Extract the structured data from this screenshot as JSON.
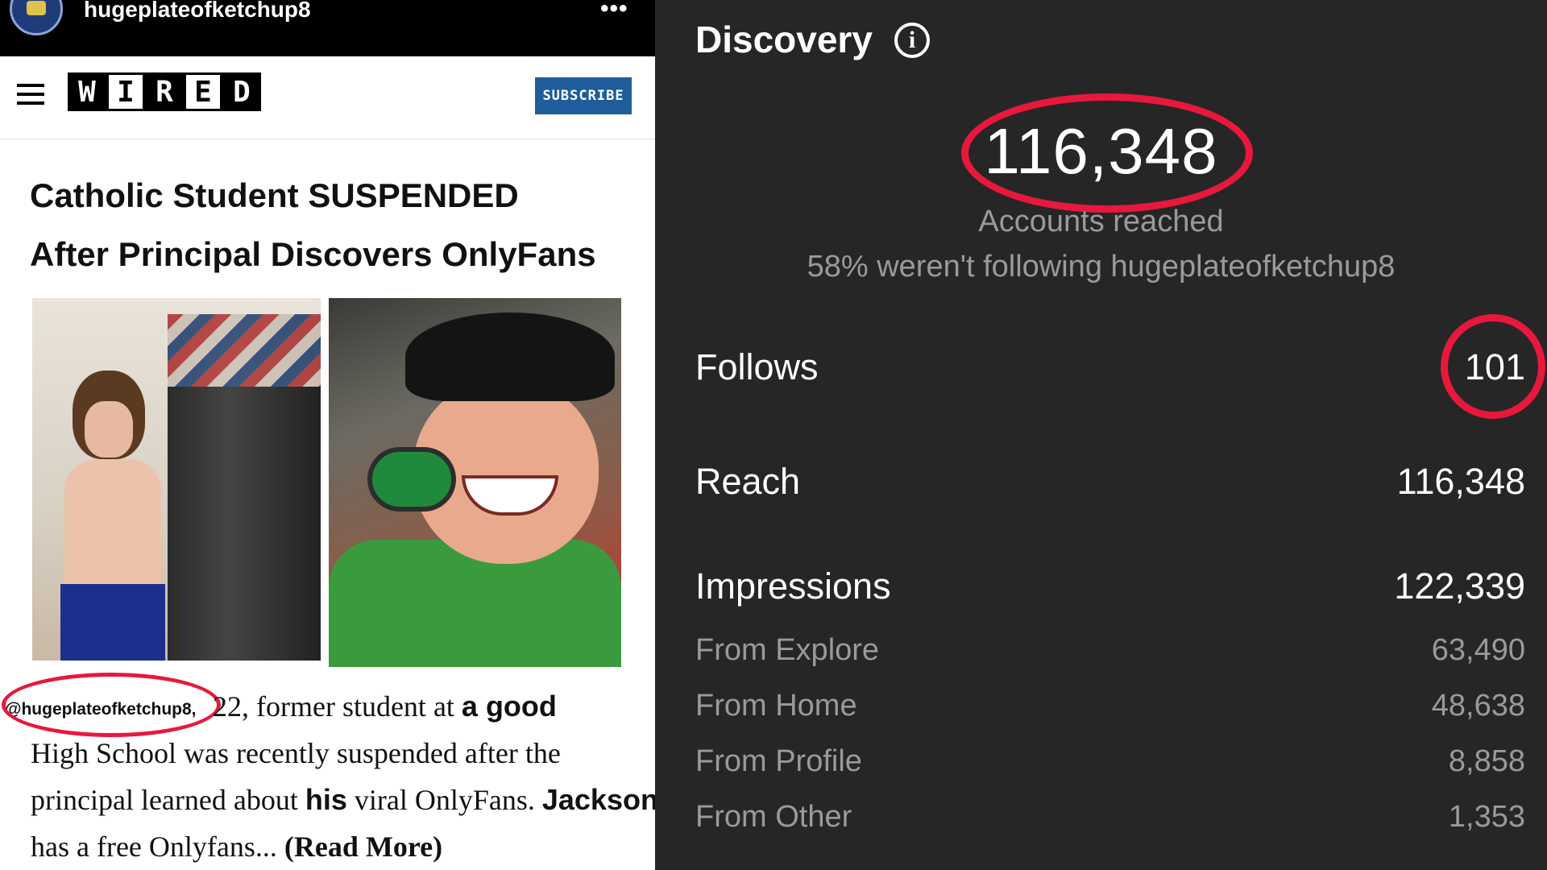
{
  "story": {
    "username": "hugeplateofketchup8",
    "more": "•••"
  },
  "article": {
    "brand_letters": [
      "W",
      "I",
      "R",
      "E",
      "D"
    ],
    "subscribe_label": "SUBSCRIBE",
    "headline_line1": "Catholic Student SUSPENDED",
    "headline_line2": "After Principal Discovers OnlyFans",
    "tag_handle": "@hugeplateofketchup8,",
    "body_line1_a": "22, former student at ",
    "body_line1_b": "a good",
    "body_line2": "High School was recently suspended after the",
    "body_line3_a": "principal learned about ",
    "body_line3_b": "his",
    "body_line3_c": " viral OnlyFans. ",
    "body_line3_d": "Jackson",
    "body_line4_a": "has a free Onlyfans... ",
    "body_line4_b": "(Read More)"
  },
  "insights": {
    "title": "Discovery",
    "info_symbol": "i",
    "accounts_reached_value": "116,348",
    "accounts_reached_label": "Accounts reached",
    "not_following_text": "58% weren't following hugeplateofketchup8",
    "metrics": [
      {
        "label": "Follows",
        "value": "101"
      },
      {
        "label": "Reach",
        "value": "116,348"
      },
      {
        "label": "Impressions",
        "value": "122,339"
      }
    ],
    "impressions_breakdown": [
      {
        "label": "From Explore",
        "value": "63,490"
      },
      {
        "label": "From Home",
        "value": "48,638"
      },
      {
        "label": "From Profile",
        "value": "8,858"
      },
      {
        "label": "From Other",
        "value": "1,353"
      }
    ]
  },
  "colors": {
    "annotation_red": "#e8183c",
    "insights_bg": "#262626",
    "subscribe_blue": "#1f5d9c"
  }
}
